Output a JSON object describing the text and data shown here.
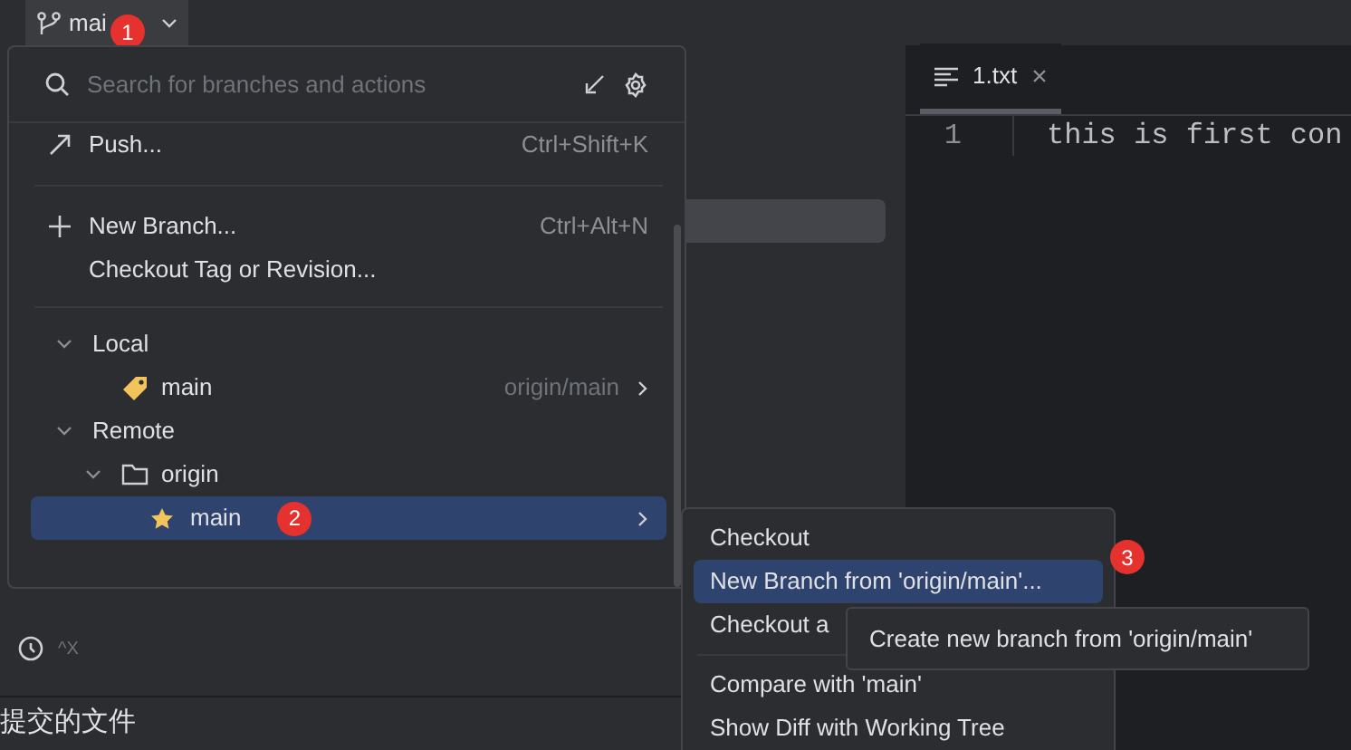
{
  "toolbar": {
    "branch": "mai",
    "badge": "1"
  },
  "editor": {
    "tab": {
      "label": "1.txt",
      "selected": true
    },
    "lines": [
      {
        "number": "1",
        "text": "this is first con"
      }
    ]
  },
  "bottom": {
    "shortcut": "^X",
    "section_title": "提交的文件"
  },
  "branch_popup": {
    "search_placeholder": "Search for branches and actions",
    "actions": [
      {
        "label": "Push...",
        "shortcut": "Ctrl+Shift+K",
        "kind": "push"
      },
      {
        "kind": "divider"
      },
      {
        "label": "New Branch...",
        "shortcut": "Ctrl+Alt+N",
        "kind": "new"
      },
      {
        "label": "Checkout Tag or Revision...",
        "kind": "plain"
      }
    ],
    "tree": [
      {
        "label": "Local",
        "expanded": true,
        "children": [
          {
            "label": "main",
            "kind": "local_branch",
            "tracking": "origin/main",
            "selected": false
          }
        ]
      },
      {
        "label": "Remote",
        "expanded": true,
        "children": [
          {
            "label": "origin",
            "expanded": true,
            "kind": "folder",
            "children": [
              {
                "label": "main",
                "kind": "remote_branch",
                "selected": true,
                "badge": "2"
              }
            ]
          }
        ]
      }
    ]
  },
  "submenu": {
    "items": [
      {
        "label": "Checkout",
        "selected": false
      },
      {
        "label": "New Branch from 'origin/main'...",
        "selected": true
      },
      {
        "label": "Checkout a",
        "selected": false
      },
      {
        "kind": "divider"
      },
      {
        "label": "Compare with 'main'",
        "selected": false
      },
      {
        "label": "Show Diff with Working Tree",
        "selected": false
      }
    ],
    "badge": "3"
  },
  "tooltip": "Create new branch from 'origin/main'"
}
